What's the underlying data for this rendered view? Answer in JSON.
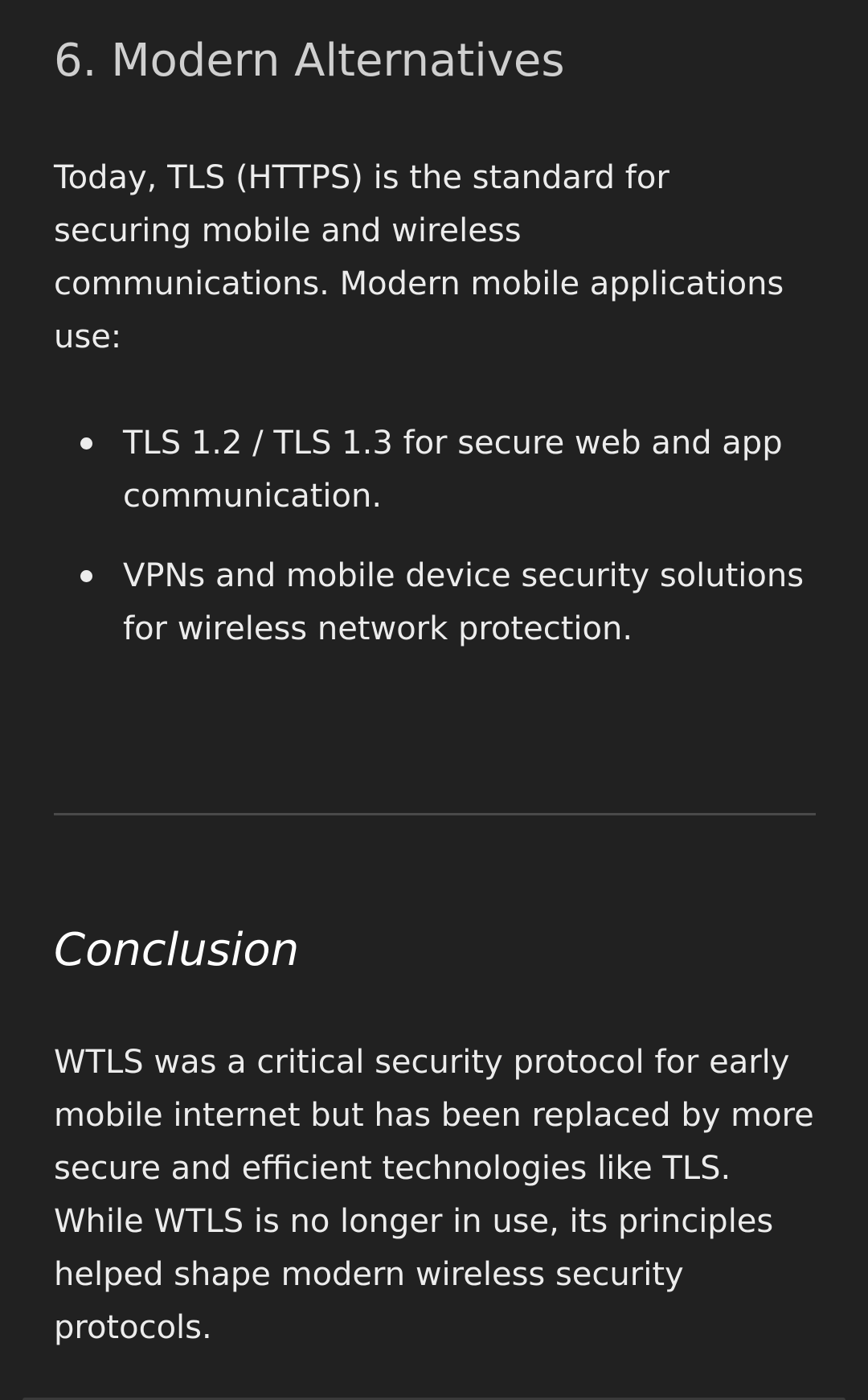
{
  "section": {
    "heading": "6. Modern Alternatives",
    "intro": "Today, TLS (HTTPS) is the standard for securing mobile and wireless communications. Modern mobile applications use:",
    "bullets": [
      "TLS 1.2 / TLS 1.3 for secure web and app communication.",
      "VPNs and mobile device security solutions for wireless network protection."
    ]
  },
  "conclusion": {
    "heading": "Conclusion",
    "text": "WTLS was a critical security protocol for early mobile internet but has been replaced by more secure and efficient technologies like TLS. While WTLS is no longer in use, its principles helped shape modern wireless security protocols."
  }
}
